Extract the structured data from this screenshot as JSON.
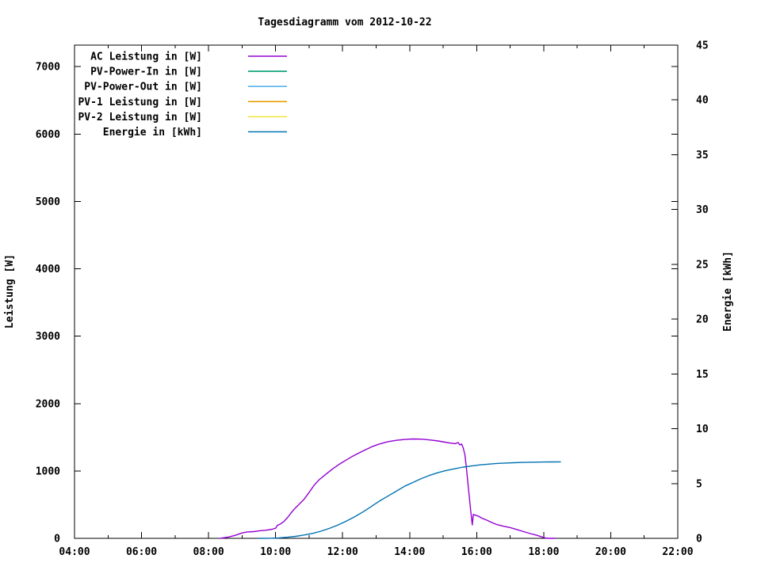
{
  "page": {
    "background": "#ffffff",
    "foreground": "#000000"
  },
  "chart_data": {
    "type": "line",
    "title": "Tagesdiagramm vom 2012-10-22",
    "x_axis": {
      "unit": "time-of-day",
      "range": [
        4,
        22
      ],
      "major_ticks": [
        4,
        6,
        8,
        10,
        12,
        14,
        16,
        18,
        20,
        22
      ],
      "major_tick_labels": [
        "04:00",
        "06:00",
        "08:00",
        "10:00",
        "12:00",
        "14:00",
        "16:00",
        "18:00",
        "20:00",
        "22:00"
      ],
      "minor_ticks": [
        5,
        7,
        9,
        11,
        13,
        15,
        17,
        19,
        21
      ]
    },
    "y_axis_left": {
      "label": "Leistung [W]",
      "range": [
        0,
        7320
      ],
      "ticks": [
        0,
        1000,
        2000,
        3000,
        4000,
        5000,
        6000,
        7000
      ],
      "tick_labels": [
        "0",
        "1000",
        "2000",
        "3000",
        "4000",
        "5000",
        "6000",
        "7000"
      ]
    },
    "y_axis_right": {
      "label": "Energie [kWh]",
      "range": [
        0,
        45
      ],
      "ticks": [
        0,
        5,
        10,
        15,
        20,
        25,
        30,
        35,
        40,
        45
      ],
      "tick_labels": [
        "0",
        "5",
        "10",
        "15",
        "20",
        "25",
        "30",
        "35",
        "40",
        "45"
      ]
    },
    "grid": false,
    "legend_position": "top-left-inside",
    "series": [
      {
        "label": "AC Leistung in [W]",
        "color": "#9400d3",
        "axis": "left",
        "points": [
          [
            8.35,
            0
          ],
          [
            8.6,
            20
          ],
          [
            8.8,
            45
          ],
          [
            9.0,
            80
          ],
          [
            9.15,
            95
          ],
          [
            9.35,
            100
          ],
          [
            9.5,
            110
          ],
          [
            9.7,
            120
          ],
          [
            9.9,
            135
          ],
          [
            10.0,
            150
          ],
          [
            10.05,
            190
          ],
          [
            10.15,
            215
          ],
          [
            10.25,
            250
          ],
          [
            10.35,
            305
          ],
          [
            10.45,
            370
          ],
          [
            10.55,
            430
          ],
          [
            10.7,
            505
          ],
          [
            10.85,
            580
          ],
          [
            11.0,
            680
          ],
          [
            11.15,
            790
          ],
          [
            11.3,
            870
          ],
          [
            11.5,
            950
          ],
          [
            11.7,
            1030
          ],
          [
            11.9,
            1100
          ],
          [
            12.1,
            1160
          ],
          [
            12.3,
            1220
          ],
          [
            12.5,
            1270
          ],
          [
            12.7,
            1320
          ],
          [
            12.9,
            1365
          ],
          [
            13.1,
            1400
          ],
          [
            13.35,
            1435
          ],
          [
            13.6,
            1455
          ],
          [
            13.85,
            1468
          ],
          [
            14.1,
            1475
          ],
          [
            14.35,
            1472
          ],
          [
            14.6,
            1460
          ],
          [
            14.85,
            1445
          ],
          [
            15.05,
            1428
          ],
          [
            15.2,
            1415
          ],
          [
            15.35,
            1405
          ],
          [
            15.45,
            1420
          ],
          [
            15.5,
            1385
          ],
          [
            15.55,
            1400
          ],
          [
            15.6,
            1340
          ],
          [
            15.65,
            1240
          ],
          [
            15.7,
            1020
          ],
          [
            15.75,
            760
          ],
          [
            15.82,
            420
          ],
          [
            15.87,
            200
          ],
          [
            15.9,
            355
          ],
          [
            15.95,
            345
          ],
          [
            16.05,
            330
          ],
          [
            16.15,
            300
          ],
          [
            16.3,
            270
          ],
          [
            16.45,
            235
          ],
          [
            16.6,
            205
          ],
          [
            16.8,
            180
          ],
          [
            17.0,
            160
          ],
          [
            17.2,
            130
          ],
          [
            17.4,
            100
          ],
          [
            17.6,
            70
          ],
          [
            17.8,
            45
          ],
          [
            17.95,
            20
          ],
          [
            18.05,
            5
          ],
          [
            18.15,
            0
          ],
          [
            18.35,
            0
          ]
        ]
      },
      {
        "label": "PV-Power-In in [W]",
        "color": "#009e73",
        "axis": "left",
        "points": []
      },
      {
        "label": "PV-Power-Out in [W]",
        "color": "#56b4e9",
        "axis": "left",
        "points": []
      },
      {
        "label": "PV-1 Leistung in [W]",
        "color": "#e69f00",
        "axis": "left",
        "points": []
      },
      {
        "label": "PV-2 Leistung in [W]",
        "color": "#f0e442",
        "axis": "left",
        "points": []
      },
      {
        "label": "Energie in [kWh]",
        "color": "#0072b2",
        "axis": "right",
        "points": [
          [
            9.5,
            0
          ],
          [
            9.8,
            0.01
          ],
          [
            10.1,
            0.04
          ],
          [
            10.35,
            0.1
          ],
          [
            10.6,
            0.18
          ],
          [
            10.85,
            0.3
          ],
          [
            11.1,
            0.45
          ],
          [
            11.35,
            0.65
          ],
          [
            11.6,
            0.9
          ],
          [
            11.85,
            1.2
          ],
          [
            12.1,
            1.55
          ],
          [
            12.35,
            1.95
          ],
          [
            12.6,
            2.4
          ],
          [
            12.85,
            2.9
          ],
          [
            13.1,
            3.4
          ],
          [
            13.35,
            3.85
          ],
          [
            13.6,
            4.3
          ],
          [
            13.85,
            4.75
          ],
          [
            14.1,
            5.1
          ],
          [
            14.35,
            5.45
          ],
          [
            14.6,
            5.75
          ],
          [
            14.85,
            6.0
          ],
          [
            15.1,
            6.2
          ],
          [
            15.35,
            6.35
          ],
          [
            15.6,
            6.5
          ],
          [
            15.85,
            6.6
          ],
          [
            16.1,
            6.7
          ],
          [
            16.35,
            6.77
          ],
          [
            16.6,
            6.83
          ],
          [
            16.85,
            6.87
          ],
          [
            17.1,
            6.9
          ],
          [
            17.4,
            6.93
          ],
          [
            17.7,
            6.95
          ],
          [
            18.0,
            6.96
          ],
          [
            18.2,
            6.97
          ],
          [
            18.5,
            6.98
          ]
        ]
      }
    ]
  }
}
